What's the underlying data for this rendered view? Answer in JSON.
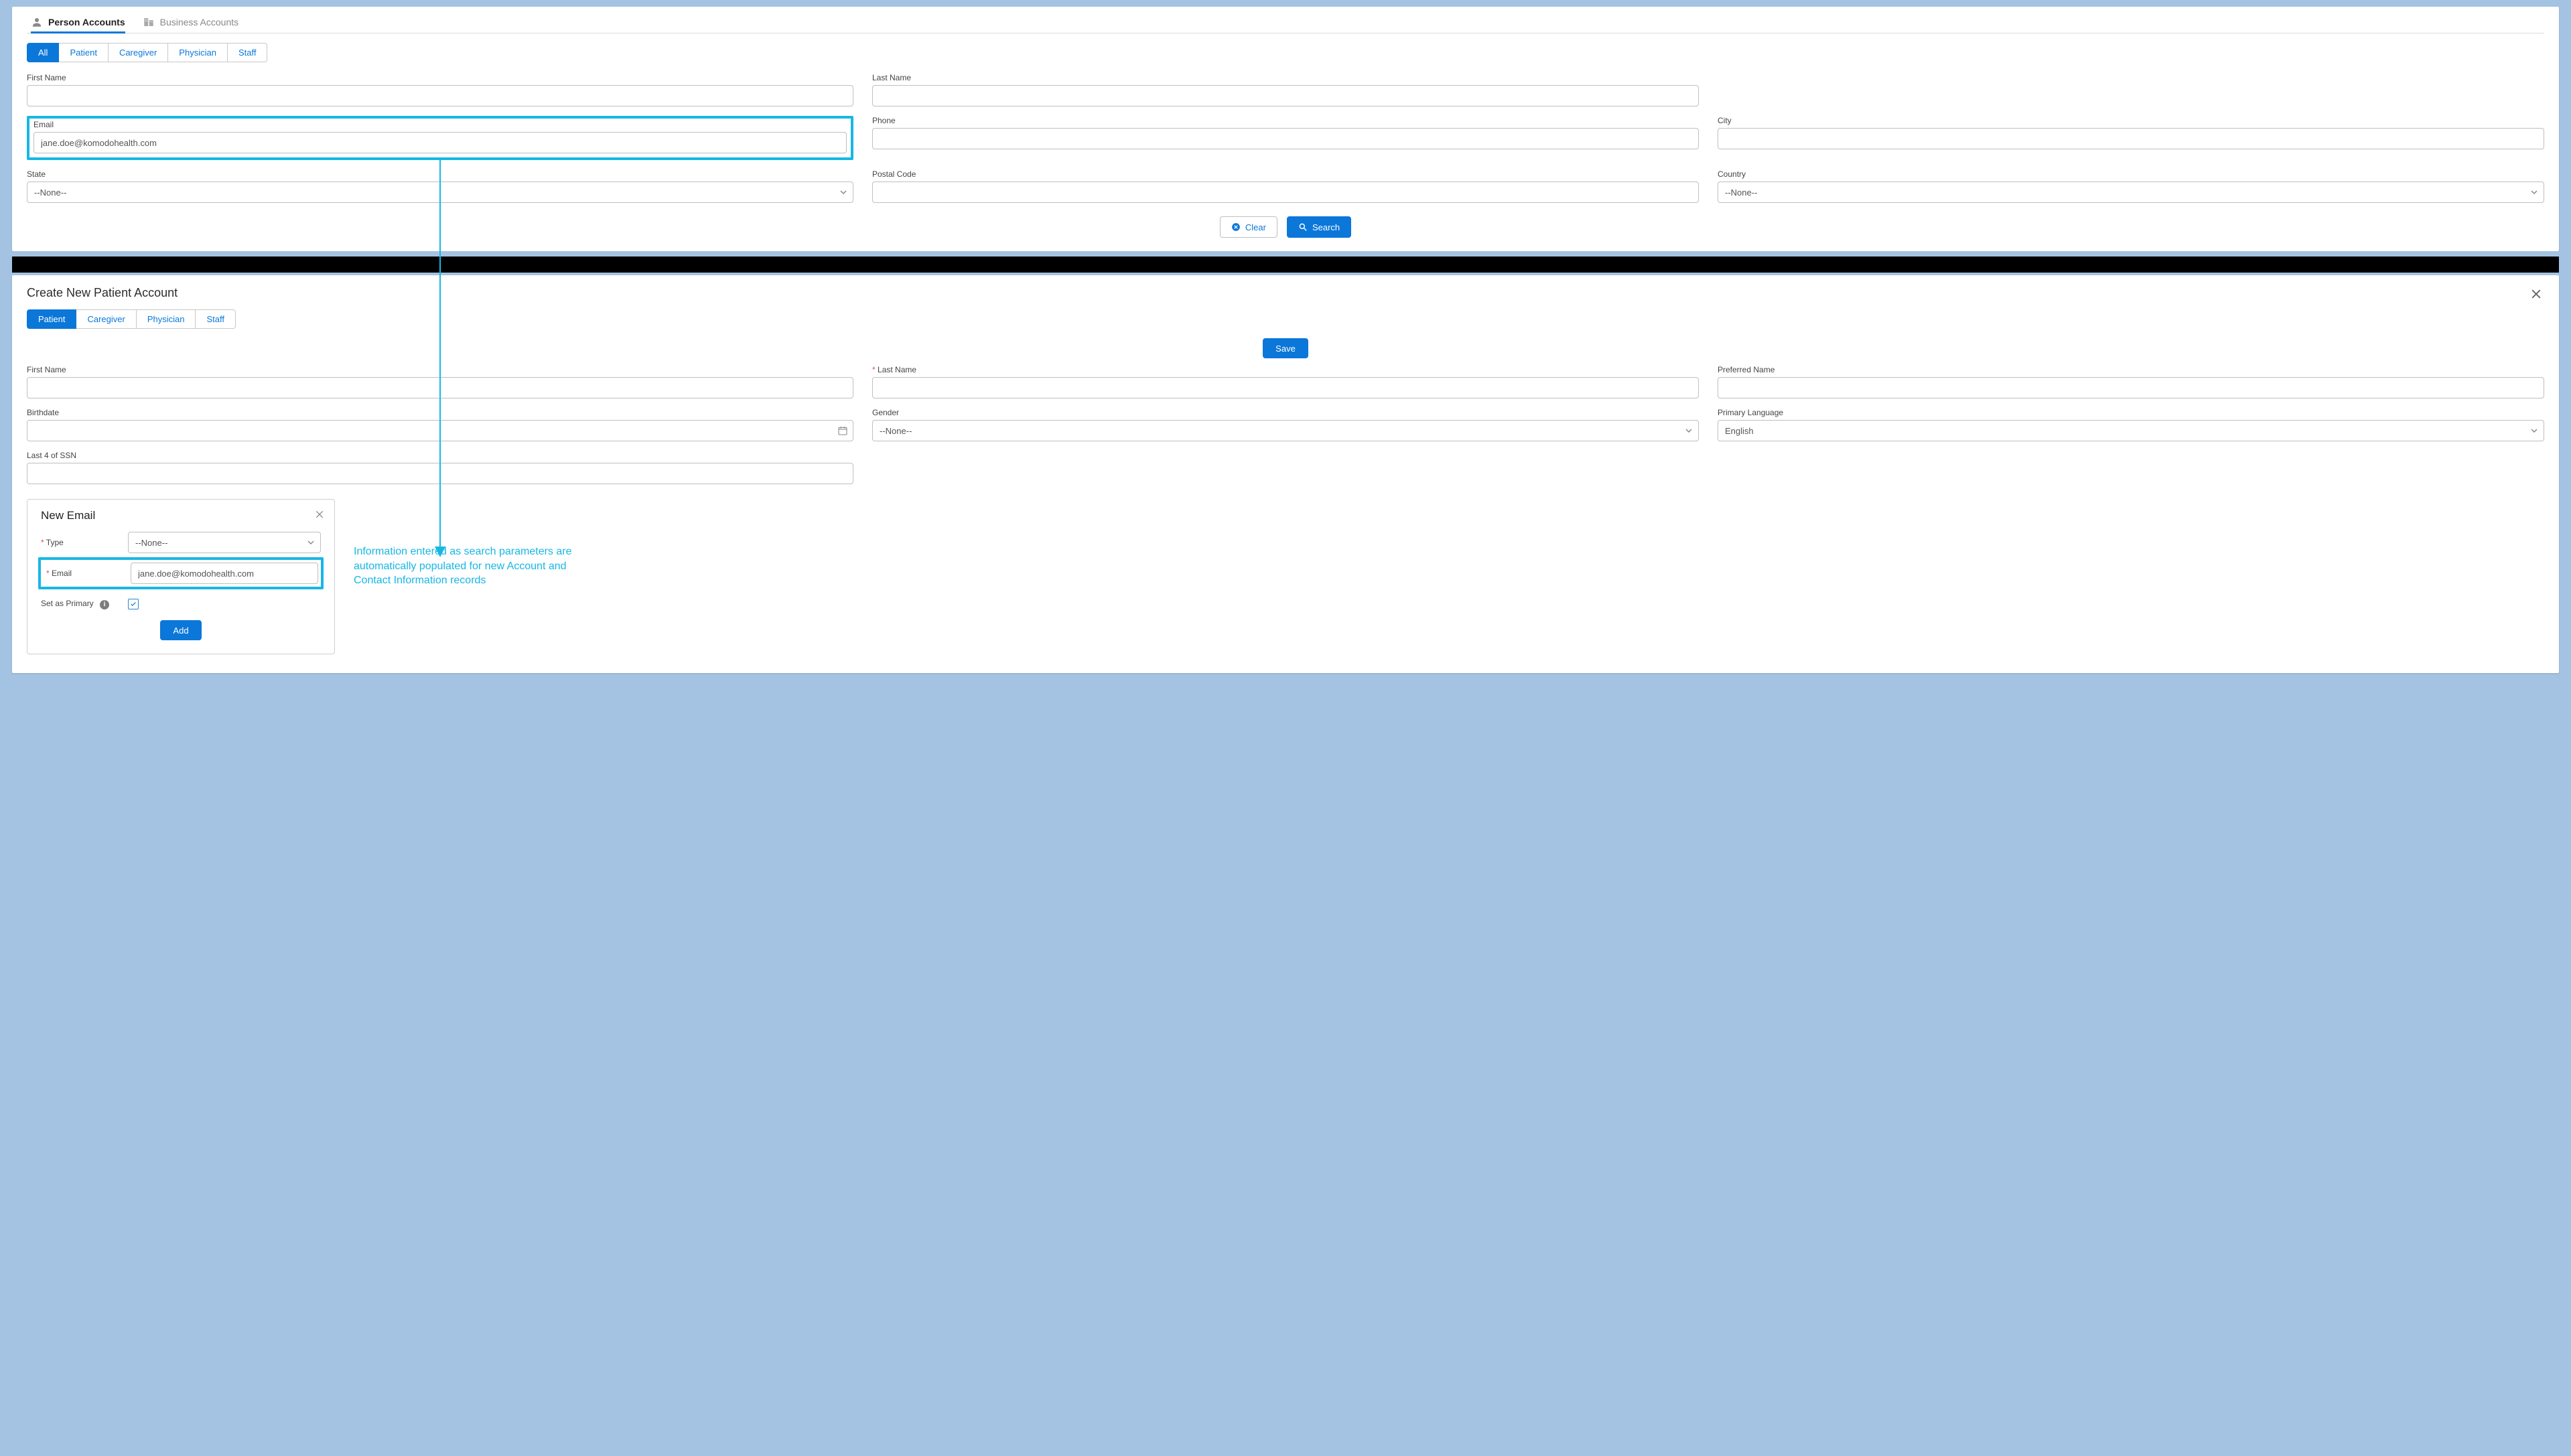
{
  "colors": {
    "accent": "#0b77d9",
    "highlight": "#17b7e5"
  },
  "top": {
    "mainTabs": {
      "person": "Person Accounts",
      "business": "Business Accounts"
    },
    "subTabs": [
      "All",
      "Patient",
      "Caregiver",
      "Physician",
      "Staff"
    ],
    "subActive": 0,
    "fields": {
      "firstName": "First Name",
      "lastName": "Last Name",
      "email": "Email",
      "emailValue": "jane.doe@komodohealth.com",
      "phone": "Phone",
      "city": "City",
      "state": "State",
      "stateValue": "--None--",
      "postal": "Postal Code",
      "country": "Country",
      "countryValue": "--None--"
    },
    "buttons": {
      "clear": "Clear",
      "search": "Search"
    }
  },
  "bottom": {
    "title": "Create New Patient Account",
    "subTabs": [
      "Patient",
      "Caregiver",
      "Physician",
      "Staff"
    ],
    "subActive": 0,
    "save": "Save",
    "fields": {
      "firstName": "First Name",
      "lastName": "Last Name",
      "preferred": "Preferred Name",
      "birthdate": "Birthdate",
      "gender": "Gender",
      "genderValue": "--None--",
      "lang": "Primary Language",
      "langValue": "English",
      "ssn": "Last 4 of SSN"
    },
    "card": {
      "title": "New Email",
      "type": "Type",
      "typeValue": "--None--",
      "email": "Email",
      "emailValue": "jane.doe@komodohealth.com",
      "primary": "Set as Primary",
      "primaryChecked": true,
      "add": "Add"
    },
    "annotation": "Information entered as search parameters are automatically populated for new Account and Contact Information records"
  }
}
